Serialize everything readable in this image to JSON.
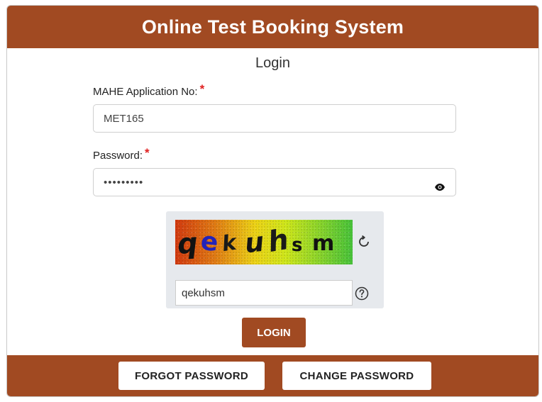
{
  "header": {
    "title": "Online Test Booking System"
  },
  "form": {
    "title": "Login",
    "application_no": {
      "label": "MAHE Application No:",
      "required_mark": "*",
      "value": "MET165"
    },
    "password": {
      "label": "Password:",
      "required_mark": "*",
      "value": "MET165abc",
      "icon": "eye-icon"
    }
  },
  "captcha": {
    "characters": [
      {
        "char": "q",
        "color": "#121212",
        "style": "italic"
      },
      {
        "char": "e",
        "color": "#2323b8",
        "style": "normal"
      },
      {
        "char": "k",
        "color": "#1a1a1a",
        "style": "italic"
      },
      {
        "char": "u",
        "color": "#141414",
        "style": "italic"
      },
      {
        "char": "h",
        "color": "#1a1a1a",
        "style": "italic"
      },
      {
        "char": "s",
        "color": "#111111",
        "style": "normal"
      },
      {
        "char": "m",
        "color": "#111111",
        "style": "normal"
      }
    ],
    "input_value": "qekuhsm",
    "refresh_icon": "refresh-icon",
    "help_icon": "help-icon"
  },
  "buttons": {
    "login": "LOGIN",
    "forgot_password": "FORGOT PASSWORD",
    "change_password": "CHANGE PASSWORD"
  },
  "colors": {
    "brand": "#a14a22",
    "required": "#e02020",
    "captcha_panel": "#e6e9ed"
  }
}
